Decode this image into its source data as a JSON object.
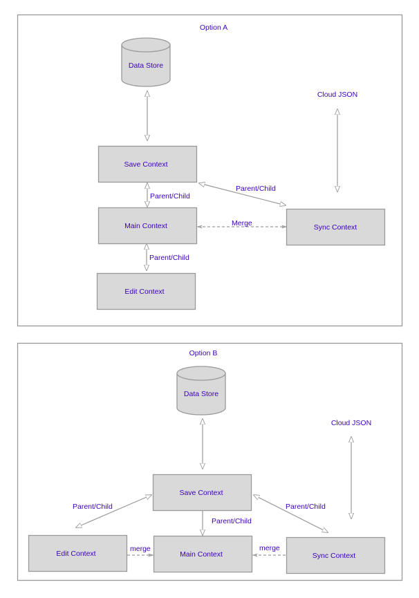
{
  "diagrams": [
    {
      "title": "Option A",
      "nodes": {
        "data_store": "Data Store",
        "cloud_json": "Cloud JSON",
        "save_context": "Save Context",
        "main_context": "Main Context",
        "edit_context": "Edit Context",
        "sync_context": "Sync Context"
      },
      "edges": {
        "store_save": "",
        "cloud_sync": "",
        "save_main": "Parent/Child",
        "main_edit": "Parent/Child",
        "save_sync": "Parent/Child",
        "main_sync": "Merge"
      }
    },
    {
      "title": "Option B",
      "nodes": {
        "data_store": "Data Store",
        "cloud_json": "Cloud JSON",
        "save_context": "Save Context",
        "main_context": "Main Context",
        "edit_context": "Edit Context",
        "sync_context": "Sync Context"
      },
      "edges": {
        "store_save": "",
        "cloud_sync": "",
        "save_edit": "Parent/Child",
        "save_main": "Parent/Child",
        "save_sync": "Parent/Child",
        "edit_main": "merge",
        "sync_main": "merge"
      }
    }
  ],
  "colors": {
    "label_text": "#3a00b8",
    "node_fill": "#d9d9d9",
    "stroke": "#999999"
  }
}
